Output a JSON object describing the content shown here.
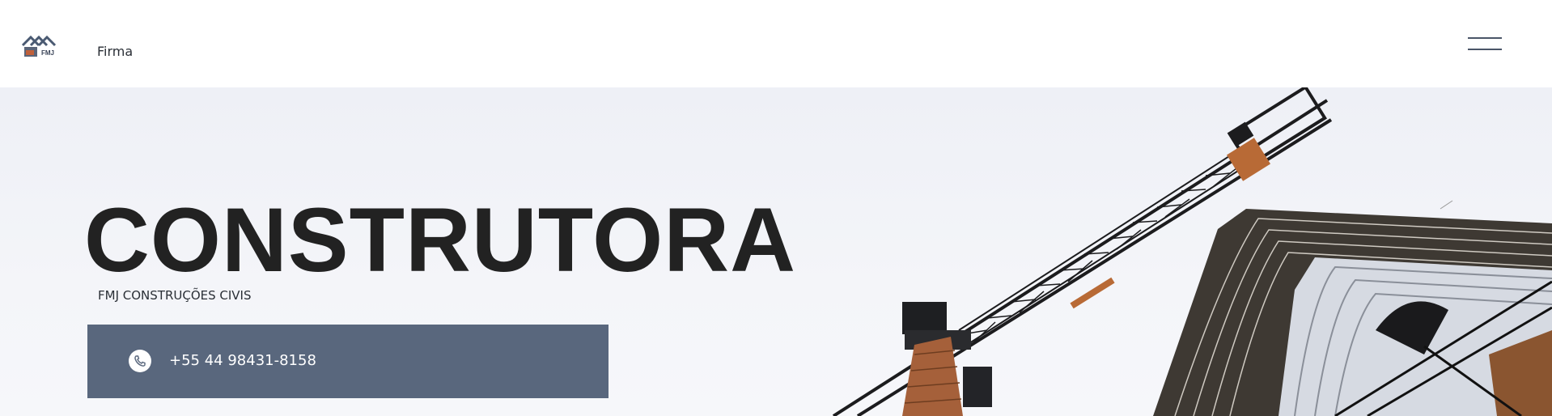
{
  "header": {
    "logo_icon": "company-logo-icon",
    "logo_text": "FMJ",
    "nav_label": "Firma",
    "menu_icon": "hamburger-menu-icon"
  },
  "hero": {
    "title": "CONSTRUTORA",
    "subtitle": "FMJ CONSTRUÇÕES CIVIS",
    "phone_label": "+55 44 98431-8158",
    "phone_icon": "phone-icon",
    "background_image": "construction-crane-building-photo"
  },
  "colors": {
    "cta_background": "#59677d",
    "title_text": "#222222",
    "crane_accent": "#b86a36"
  }
}
